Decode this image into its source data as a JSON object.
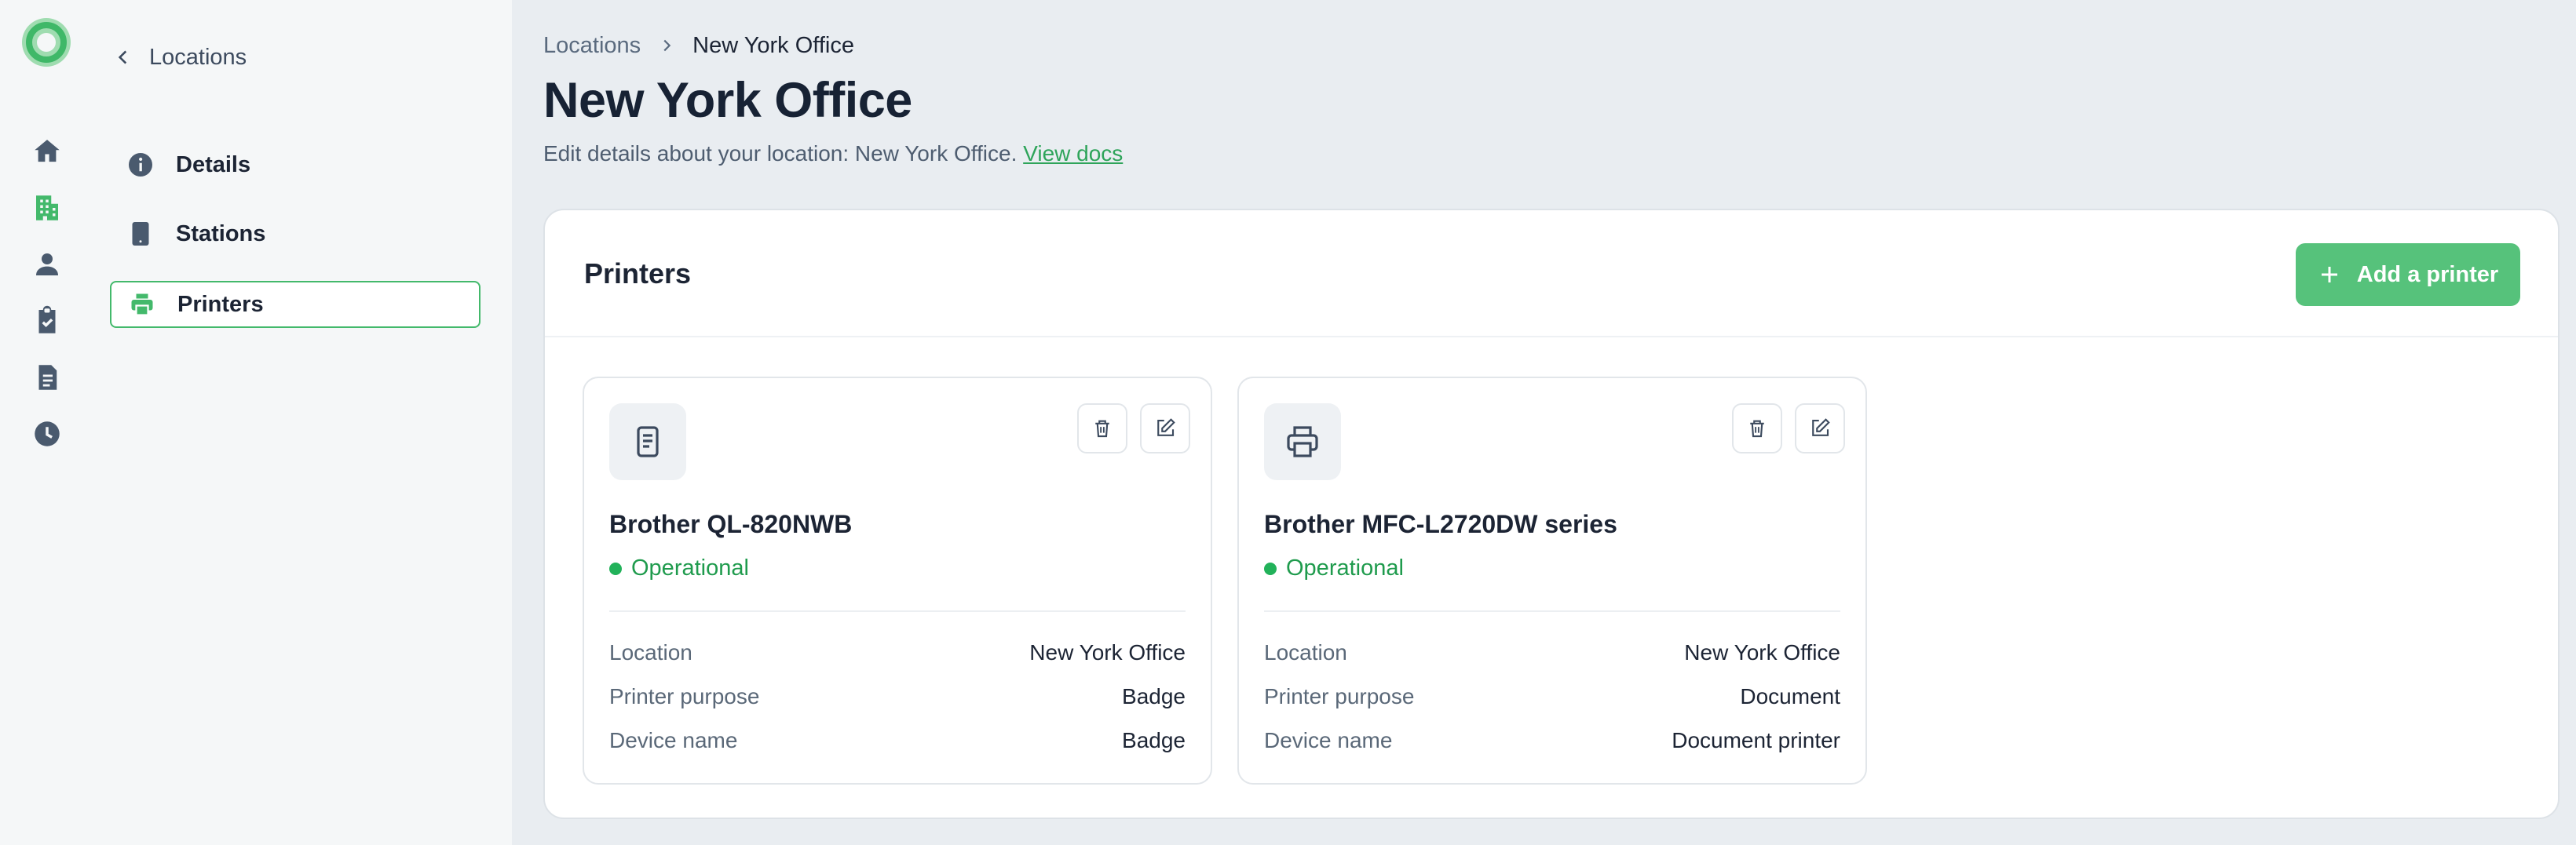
{
  "rail": {
    "logo": "app-logo",
    "items": [
      {
        "icon": "home-icon",
        "active": false
      },
      {
        "icon": "building-icon",
        "active": true
      },
      {
        "icon": "person-icon",
        "active": false
      },
      {
        "icon": "clipboard-check-icon",
        "active": false
      },
      {
        "icon": "document-icon",
        "active": false
      },
      {
        "icon": "clock-icon",
        "active": false
      }
    ]
  },
  "subnav": {
    "back_label": "Locations",
    "items": [
      {
        "label": "Details",
        "icon": "info-icon",
        "active": false
      },
      {
        "label": "Stations",
        "icon": "tablet-icon",
        "active": false
      },
      {
        "label": "Printers",
        "icon": "printer-icon",
        "active": true
      }
    ]
  },
  "breadcrumb": {
    "parent": "Locations",
    "current": "New York Office"
  },
  "page": {
    "title": "New York Office",
    "subtitle": "Edit details about your location: New York Office.",
    "docs_link": "View docs"
  },
  "panel": {
    "title": "Printers",
    "add_button_label": "Add a printer"
  },
  "printers": [
    {
      "icon": "label-document-icon",
      "name": "Brother QL-820NWB",
      "status": "Operational",
      "rows": [
        {
          "label": "Location",
          "value": "New York Office"
        },
        {
          "label": "Printer purpose",
          "value": "Badge"
        },
        {
          "label": "Device name",
          "value": "Badge"
        }
      ]
    },
    {
      "icon": "printer-icon",
      "name": "Brother MFC-L2720DW series",
      "status": "Operational",
      "rows": [
        {
          "label": "Location",
          "value": "New York Office"
        },
        {
          "label": "Printer purpose",
          "value": "Document"
        },
        {
          "label": "Device name",
          "value": "Document printer"
        }
      ]
    }
  ],
  "colors": {
    "accent": "#56c27b",
    "status_ok": "#1f9b4d",
    "rail_icon": "#4a5a6e",
    "rail_icon_active": "#43b96b"
  }
}
